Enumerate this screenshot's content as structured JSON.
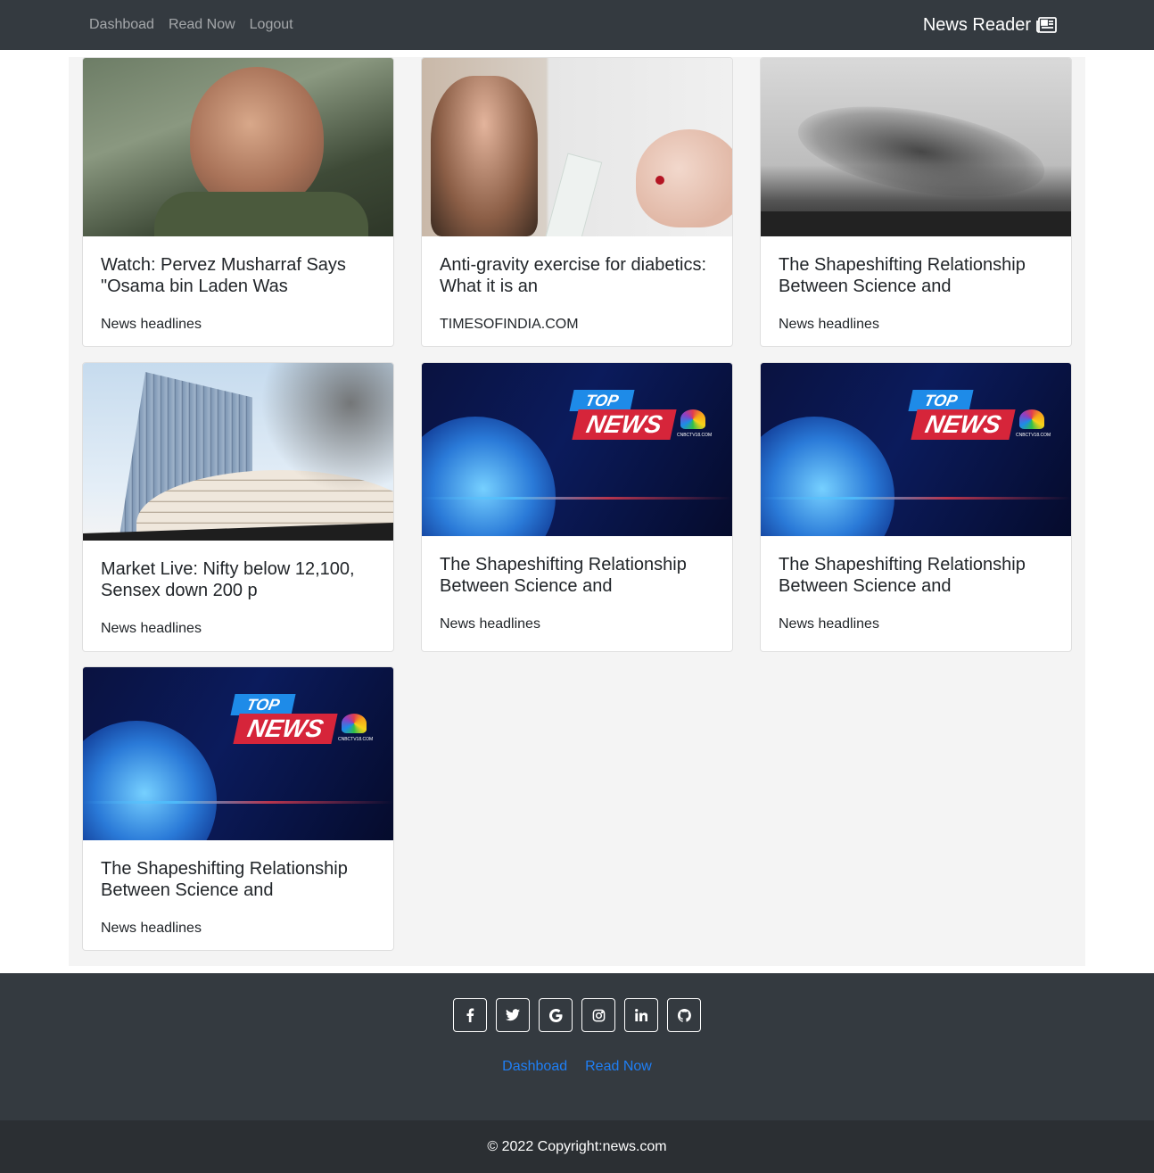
{
  "nav": {
    "links": [
      "Dashboad",
      "Read Now",
      "Logout"
    ],
    "brand": "News Reader",
    "brand_icon": "newspaper-icon"
  },
  "cards": [
    {
      "title": "Watch: Pervez Musharraf Says \"Osama bin Laden Was",
      "source": "News headlines",
      "image": "musharraf-photo"
    },
    {
      "title": "Anti-gravity exercise for diabetics: What it is an",
      "source": "TIMESOFINDIA.COM",
      "image": "exercise-diabetes-photo"
    },
    {
      "title": "The Shapeshifting Relationship Between Science and",
      "source": "News headlines",
      "image": "bird-flock-photo"
    },
    {
      "title": "Market Live: Nifty below 12,100, Sensex down 200 p",
      "source": "News headlines",
      "image": "bse-building-photo"
    },
    {
      "title": "The Shapeshifting Relationship Between Science and",
      "source": "News headlines",
      "image": "top-news-banner"
    },
    {
      "title": "The Shapeshifting Relationship Between Science and",
      "source": "News headlines",
      "image": "top-news-banner"
    },
    {
      "title": "The Shapeshifting Relationship Between Science and",
      "source": "News headlines",
      "image": "top-news-banner"
    }
  ],
  "banner": {
    "top": "TOP",
    "news": "NEWS",
    "url": "CNBCTV18.COM"
  },
  "footer": {
    "social_icons": [
      "facebook-icon",
      "twitter-icon",
      "google-icon",
      "instagram-icon",
      "linkedin-icon",
      "github-icon"
    ],
    "links": [
      "Dashboad",
      "Read Now"
    ],
    "copyright": "© 2022 Copyright:news.com"
  }
}
